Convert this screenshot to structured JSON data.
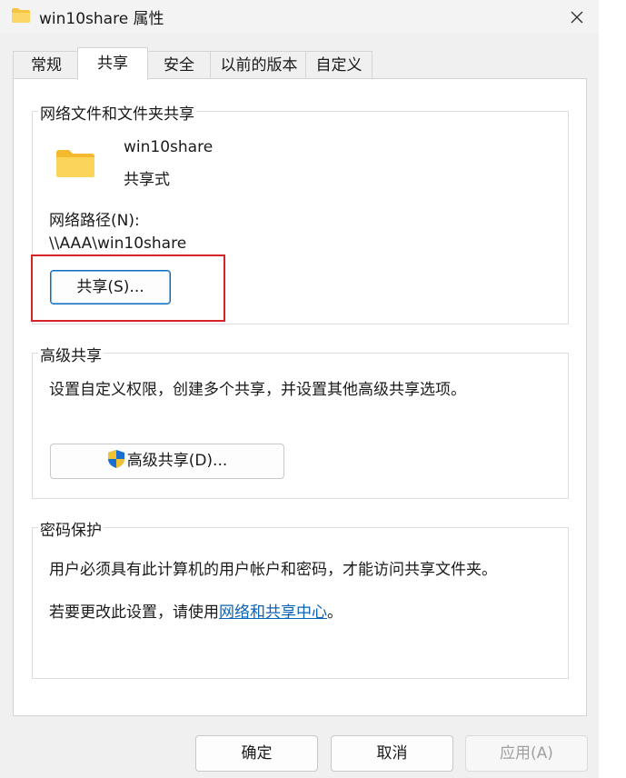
{
  "window": {
    "title": "win10share 属性"
  },
  "tabs": [
    {
      "label": "常规"
    },
    {
      "label": "共享"
    },
    {
      "label": "安全"
    },
    {
      "label": "以前的版本"
    },
    {
      "label": "自定义"
    }
  ],
  "network_share": {
    "group_label": "网络文件和文件夹共享",
    "folder_name": "win10share",
    "share_status": "共享式",
    "network_path_label": "网络路径(N):",
    "network_path": "\\\\AAA\\win10share",
    "share_button": "共享(S)..."
  },
  "advanced_share": {
    "group_label": "高级共享",
    "description": "设置自定义权限，创建多个共享，并设置其他高级共享选项。",
    "button": "高级共享(D)..."
  },
  "password_protection": {
    "group_label": "密码保护",
    "description": "用户必须具有此计算机的用户帐户和密码，才能访问共享文件夹。",
    "change_text": "若要更改此设置，请使用",
    "link_text": "网络和共享中心",
    "period": "。"
  },
  "footer": {
    "ok": "确定",
    "cancel": "取消",
    "apply": "应用(A)"
  },
  "colors": {
    "link": "#0a62b8",
    "highlight": "#d7232a",
    "folder": "#f8c94a"
  }
}
